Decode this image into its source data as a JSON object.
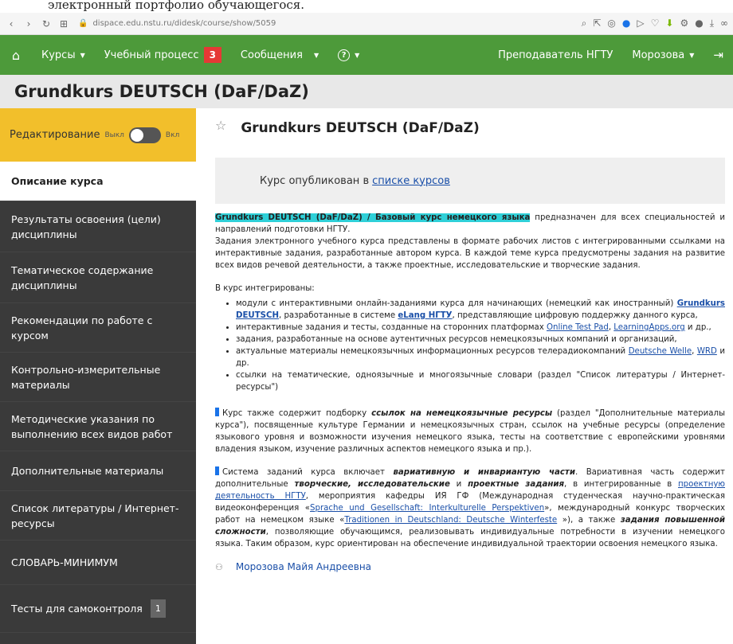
{
  "top_strip": "электронный портфолио обучающегося.",
  "browser": {
    "url": "dispace.edu.nstu.ru/didesk/course/show/5059"
  },
  "nav": {
    "courses": "Курсы",
    "study_process": "Учебный процесс",
    "study_badge": "3",
    "messages": "Сообщения",
    "help": "?",
    "teacher": "Преподаватель НГТУ",
    "user": "Морозова"
  },
  "page_title": "Grundkurs DEUTSCH (DaF/DaZ)",
  "sidebar": {
    "edit_label": "Редактирование",
    "edit_off": "Выкл",
    "edit_on": "Вкл",
    "items": [
      {
        "label": "Описание курса"
      },
      {
        "label": "Результаты освоения (цели) дисциплины"
      },
      {
        "label": "Тематическое содержание дисциплины"
      },
      {
        "label": "Рекомендации по работе с курсом"
      },
      {
        "label": "Контрольно-измерительные материалы"
      },
      {
        "label": "Методические указания по выполнению всех видов работ"
      },
      {
        "label": "Дополнительные материалы"
      },
      {
        "label": "Список литературы / Интернет-ресурсы"
      },
      {
        "label": "СЛОВАРЬ-МИНИМУМ"
      },
      {
        "label": "Тесты для самоконтроля",
        "count": "1"
      }
    ]
  },
  "content": {
    "title": "Grundkurs DEUTSCH (DaF/DaZ)",
    "published_text": "Курс опубликован в",
    "published_link": "списке курсов",
    "intro_highlight": "Grundkurs DEUTSCH (DaF/DaZ) / Базовый курс немецкого языка",
    "intro_rest": " предназначен для всех специальностей и направлений подготовки НГТУ.",
    "para2": "Задания электронного учебного курса представлены в формате рабочих листов с интегрированными ссылками на интерактивные задания, разработанные автором курса. В каждой теме курса предусмотрены задания на развитие всех видов речевой деятельности, а также проектные, исследовательские и творческие задания.",
    "integrated_label": "В курс интегрированы:",
    "bullet1_a": "модули с интерактивными онлайн-заданиями курса для начинающих (немецкий как иностранный) ",
    "bullet1_link1": "Grundkurs DEUTSCH",
    "bullet1_b": ", разработанные в системе ",
    "bullet1_link2": "eLang НГТУ",
    "bullet1_c": ", представляющие цифровую поддержку данного курса,",
    "bullet2_a": "интерактивные задания и тесты, созданные на сторонних платформах ",
    "bullet2_link1": "Online Test Pad",
    "bullet2_b": ", ",
    "bullet2_link2": "LearningApps.org",
    "bullet2_c": " и др.,",
    "bullet3": "задания, разработанные на основе аутентичных ресурсов немецкоязычных компаний и организаций,",
    "bullet4_a": "актуальные материалы немецкоязычных информационных ресурсов телерадиокомпаний ",
    "bullet4_link1": "Deutsche Welle",
    "bullet4_b": ", ",
    "bullet4_link2": "WRD",
    "bullet4_c": " и др.",
    "bullet5": "ссылки на тематические, одноязычные и многоязычные словари (раздел \"Список литературы / Интернет-ресурсы\")",
    "para3_a": "Курс также содержит подборку ",
    "para3_bold": "ссылок на немецкоязычные ресурсы",
    "para3_b": " (раздел \"Дополнительные материалы курса\"), посвященные культуре Германии и немецкоязычных стран, ссылок на учебные ресурсы (определение языкового уровня и возможности изучения немецкого языка, тесты на соответствие с европейскими уровнями владения языком, изучение различных аспектов немецкого языка и пр.).",
    "para4_a": "Система заданий курса включает ",
    "para4_bold1": "вариативную и инвариантую части",
    "para4_b": ". Вариативная часть содержит дополнительные ",
    "para4_bold2": "творческие, исследовательские",
    "para4_c": " и ",
    "para4_bold3": "проектные задания",
    "para4_d": ", в интегрированные в ",
    "para4_link1": "проектную деятельность НГТУ",
    "para4_e": ", мероприятия кафедры ИЯ ГФ (Международная студенческая научно-практическая видеоконференция «",
    "para4_link2": "Sprache und Gesellschaft: Interkulturelle Perspektiven",
    "para4_f": "», международный конкурс творческих работ на немецком языке «",
    "para4_link3": "Traditionen in Deutschland: Deutsche Winterfeste",
    "para4_g": " »), а также ",
    "para4_bold4": "задания повышенной сложности",
    "para4_h": ", позволяющие обучающимся, реализовывать индивидуальные потребности в изучении немецкого языка. Таким образом, курс ориентирован на обеспечение индивидуальной траектории освоения немецкого языка.",
    "teacher_name": "Морозова Майя Андреевна"
  }
}
